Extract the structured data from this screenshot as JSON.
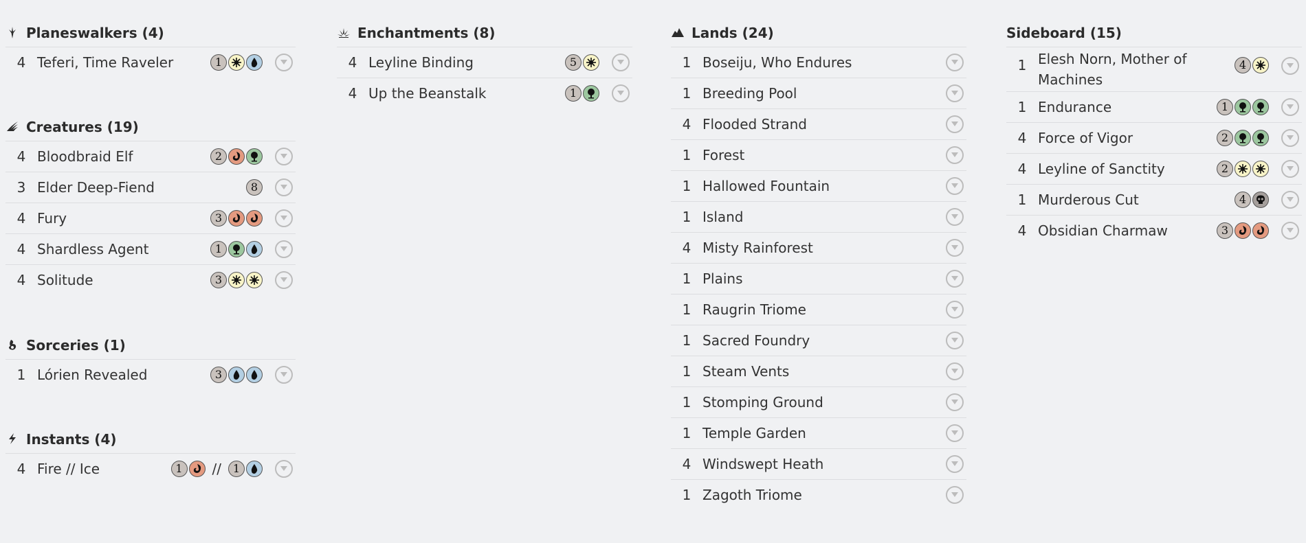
{
  "columns": [
    {
      "groups": [
        {
          "title": "Planeswalkers (4)",
          "icon": "planeswalker-icon",
          "cards": [
            {
              "qty": "4",
              "name": "Teferi, Time Raveler",
              "cost": [
                "1",
                "W",
                "U"
              ]
            }
          ]
        },
        {
          "title": "Creatures (19)",
          "icon": "creature-icon",
          "cards": [
            {
              "qty": "4",
              "name": "Bloodbraid Elf",
              "cost": [
                "2",
                "R",
                "G"
              ]
            },
            {
              "qty": "3",
              "name": "Elder Deep-Fiend",
              "cost": [
                "8"
              ]
            },
            {
              "qty": "4",
              "name": "Fury",
              "cost": [
                "3",
                "R",
                "R"
              ]
            },
            {
              "qty": "4",
              "name": "Shardless Agent",
              "cost": [
                "1",
                "G",
                "U"
              ]
            },
            {
              "qty": "4",
              "name": "Solitude",
              "cost": [
                "3",
                "W",
                "W"
              ]
            }
          ]
        },
        {
          "title": "Sorceries (1)",
          "icon": "sorcery-icon",
          "cards": [
            {
              "qty": "1",
              "name": "Lórien Revealed",
              "cost": [
                "3",
                "U",
                "U"
              ]
            }
          ]
        },
        {
          "title": "Instants (4)",
          "icon": "instant-icon",
          "cards": [
            {
              "qty": "4",
              "name": "Fire // Ice",
              "cost": [
                "1",
                "R",
                "//",
                "1",
                "U"
              ]
            }
          ]
        }
      ]
    },
    {
      "groups": [
        {
          "title": "Enchantments (8)",
          "icon": "enchantment-icon",
          "cards": [
            {
              "qty": "4",
              "name": "Leyline Binding",
              "cost": [
                "5",
                "W"
              ]
            },
            {
              "qty": "4",
              "name": "Up the Beanstalk",
              "cost": [
                "1",
                "G"
              ]
            }
          ]
        }
      ]
    },
    {
      "groups": [
        {
          "title": "Lands (24)",
          "icon": "land-icon",
          "cards": [
            {
              "qty": "1",
              "name": "Boseiju, Who Endures",
              "cost": []
            },
            {
              "qty": "1",
              "name": "Breeding Pool",
              "cost": []
            },
            {
              "qty": "4",
              "name": "Flooded Strand",
              "cost": []
            },
            {
              "qty": "1",
              "name": "Forest",
              "cost": []
            },
            {
              "qty": "1",
              "name": "Hallowed Fountain",
              "cost": []
            },
            {
              "qty": "1",
              "name": "Island",
              "cost": []
            },
            {
              "qty": "4",
              "name": "Misty Rainforest",
              "cost": []
            },
            {
              "qty": "1",
              "name": "Plains",
              "cost": []
            },
            {
              "qty": "1",
              "name": "Raugrin Triome",
              "cost": []
            },
            {
              "qty": "1",
              "name": "Sacred Foundry",
              "cost": []
            },
            {
              "qty": "1",
              "name": "Steam Vents",
              "cost": []
            },
            {
              "qty": "1",
              "name": "Stomping Ground",
              "cost": []
            },
            {
              "qty": "1",
              "name": "Temple Garden",
              "cost": []
            },
            {
              "qty": "4",
              "name": "Windswept Heath",
              "cost": []
            },
            {
              "qty": "1",
              "name": "Zagoth Triome",
              "cost": []
            }
          ]
        }
      ]
    },
    {
      "groups": [
        {
          "title": "Sideboard (15)",
          "icon": "",
          "cards": [
            {
              "qty": "1",
              "name": "Elesh Norn, Mother of Machines",
              "cost": [
                "4",
                "W"
              ]
            },
            {
              "qty": "1",
              "name": "Endurance",
              "cost": [
                "1",
                "G",
                "G"
              ]
            },
            {
              "qty": "4",
              "name": "Force of Vigor",
              "cost": [
                "2",
                "G",
                "G"
              ]
            },
            {
              "qty": "4",
              "name": "Leyline of Sanctity",
              "cost": [
                "2",
                "W",
                "W"
              ]
            },
            {
              "qty": "1",
              "name": "Murderous Cut",
              "cost": [
                "4",
                "B"
              ]
            },
            {
              "qty": "4",
              "name": "Obsidian Charmaw",
              "cost": [
                "3",
                "R",
                "R"
              ]
            }
          ]
        }
      ]
    }
  ],
  "mana_colors": {
    "generic": "#c9c2bd",
    "W": "#f8f4c8",
    "U": "#b3cfe3",
    "B": "#a59f9c",
    "R": "#e49a80",
    "G": "#9cc79f"
  },
  "mana_icons": {
    "W": "sun-icon",
    "U": "water-drop-icon",
    "B": "skull-icon",
    "R": "fire-icon",
    "G": "tree-icon"
  },
  "row_menu_icon": "chevron-down-icon"
}
